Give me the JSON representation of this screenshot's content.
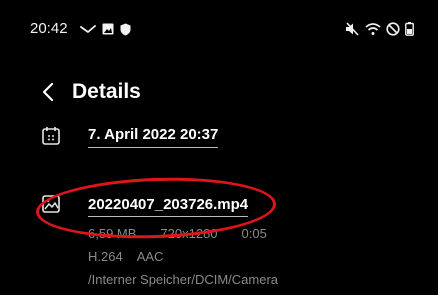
{
  "status_bar": {
    "time": "20:42",
    "left_icons": [
      "missed-call-icon",
      "image-icon",
      "shield-icon"
    ],
    "right_icons": [
      "mute-icon",
      "wifi-icon",
      "do-not-disturb-icon",
      "battery-icon"
    ]
  },
  "header": {
    "back_icon": "chevron-left-icon",
    "title": "Details"
  },
  "details": {
    "date": "7. April 2022 20:37",
    "file_name": "20220407_203726.mp4",
    "size": "6,59 MB",
    "resolution": "720x1280",
    "duration": "0:05",
    "video_codec": "H.264",
    "audio_codec": "AAC",
    "path": "/Interner Speicher/DCIM/Camera"
  },
  "colors": {
    "background": "#000000",
    "text": "#ffffff",
    "secondary_text": "#8a8a8a",
    "annotation": "#e0141b"
  }
}
